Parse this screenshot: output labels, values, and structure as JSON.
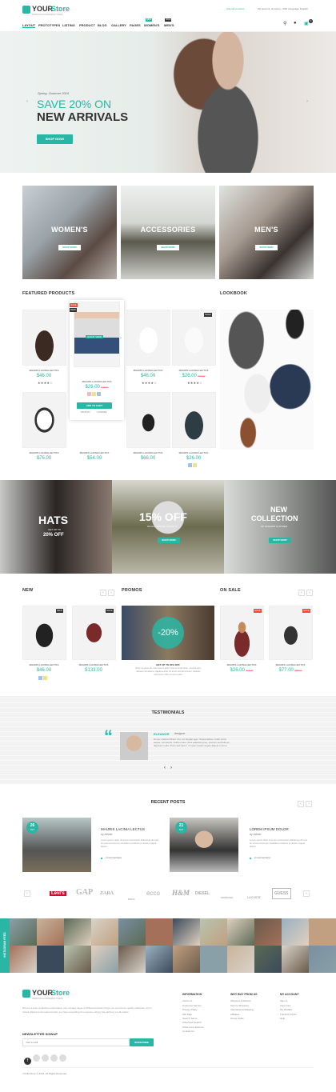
{
  "header": {
    "logo_main": "YOUR",
    "logo_accent": "Store",
    "tagline": "premium ecommerce theme",
    "top_links": [
      "Add all countries",
      "My account",
      "Currency: USD",
      "Language: English"
    ],
    "cart_count": "0",
    "nav": [
      {
        "label": "LAYOUT",
        "active": true
      },
      {
        "label": "PROTOTYPES"
      },
      {
        "label": "LISTING"
      },
      {
        "label": "PRODUCT"
      },
      {
        "label": "BLOG"
      },
      {
        "label": "GALLERY"
      },
      {
        "label": "PAGES"
      },
      {
        "label": "WOMEN'S",
        "badge": "NEW"
      },
      {
        "label": "MEN'S",
        "badge": "SALE"
      }
    ]
  },
  "hero": {
    "eyebrow": "Spring -Summer 2016",
    "line1": "SAVE 20% ON",
    "line2": "NEW ARRIVALS",
    "button": "SHOP NOW!"
  },
  "categories": [
    {
      "label": "WOMEN'S",
      "button": "SHOP NOW!"
    },
    {
      "label": "ACCESSORIES",
      "button": "SHOP NOW!"
    },
    {
      "label": "MEN'S",
      "button": "SHOP NOW!"
    }
  ],
  "featured": {
    "title": "FEATURED PRODUCTS",
    "row1": [
      {
        "name": "MAURIS LACINIA LECTUS",
        "price": "$46.00"
      },
      {
        "name": "MAURIS LACINIA LECTUS",
        "price": "$26.00",
        "old": "$48.00",
        "quick": "QUICK VIEW",
        "button": "ADD TO CART",
        "wish": "WISHLIST",
        "compare": "COMPARE",
        "badge1": "SALE",
        "badge2": "NEW"
      },
      {
        "name": "MAURIS LACINIA LECTUS",
        "price": "$46.00"
      },
      {
        "name": "MAURIS LACINIA LECTUS",
        "price": "$26.00",
        "old": "$48.00",
        "badge1": "SALE"
      }
    ],
    "row2": [
      {
        "name": "MAURIS LACINIA LECTUS",
        "price": "$76.00"
      },
      {
        "name": "MAURIS LACINIA LECTUS",
        "price": "$54.00"
      },
      {
        "name": "MAURIS LACINIA LECTUS",
        "price": "$66.00"
      },
      {
        "name": "MAURIS LACINIA LECTUS",
        "price": "$26.00"
      }
    ]
  },
  "lookbook": {
    "title": "LOOKBOOK"
  },
  "promo_banners": [
    {
      "title": "HATS",
      "sub1": "GET UP TO",
      "sub2": "20% OFF"
    },
    {
      "title": "15% OFF",
      "sub": "ON ALL WINTER JACKETS",
      "button": "SHOP NOW!"
    },
    {
      "title1": "NEW",
      "title2": "COLLECTION",
      "sub": "OF FASHION CLOTHES",
      "button": "SHOP NOW!"
    }
  ],
  "new": {
    "title": "NEW",
    "items": [
      {
        "name": "MAURIS LACINIA LECTUS",
        "price": "$46.00",
        "badge": "NEW"
      },
      {
        "name": "MAURIS LACINIA LECTUS",
        "price": "$133.00",
        "badge": "SALE"
      }
    ]
  },
  "promos": {
    "title": "PROMOS",
    "badge": "-20%",
    "caption": "GET UP TO 20% OFF",
    "text": "Dolor sit amet elit. Nam ipsum dolor. Sed ut turpis dolor, suscipit quis. Aenean vel tellus a, dapibus dolor sit amet, tincidunt lorem. Aliquam sed ipsum dolor sit amet justo."
  },
  "on_sale": {
    "title": "ON SALE",
    "items": [
      {
        "name": "MAURIS LACINIA LECTUS",
        "price": "$26.00",
        "old": "$48.00",
        "badge": "SALE"
      },
      {
        "name": "MAURIS LACINIA LECTUS",
        "price": "$77.00",
        "old": "$88.00",
        "badge": "SALE"
      }
    ]
  },
  "testimonials": {
    "title": "TESTIMONIALS",
    "name": "ELEANOR",
    "role": "designer",
    "quote": "Donec eleifend libero nisi, vel feugiat eget. Suspendisse mollis porta augue, vel iaculis. Nulla ornare risus adipiscing leo, pretium sed felis ac, dignissim odio. Proin sed lorem. Ut quis mauris augue aliquet et arcu."
  },
  "recent_posts": {
    "title": "RECENT POSTS",
    "posts": [
      {
        "day": "26",
        "month": "OCT",
        "title": "MAURIS LACINIA LECTUS",
        "by": "by Admin",
        "text": "Lorem ipsum dolor sit amet consectetur adipiscing elit sed do eiusmod tempor incididunt ut labore et dolore magna aliqua.",
        "comments": "2 comments(s)"
      },
      {
        "day": "21",
        "month": "OCT",
        "title": "LOREM IPSUM DOLOR",
        "by": "by Admin",
        "text": "Lorem ipsum dolor sit amet consectetur adipiscing elit sed do eiusmod tempor incididunt ut labore et dolore magna aliqua.",
        "comments": "2 comments(s)"
      }
    ]
  },
  "brands": [
    "Levi's",
    "GAP",
    "ZARA",
    "POLO",
    "ecco",
    "H&M",
    "DIESEL",
    "OSHKOSH",
    "LACOSTE",
    "GUESS"
  ],
  "instagram": {
    "label": "INSTAGRAM FEED"
  },
  "footer": {
    "logo_main": "YOUR",
    "logo_accent": "Store",
    "tagline": "premium ecommerce theme",
    "about": "We are a team of fashion enthusiasts. Our curated range of different brands brings you a premium quality wardrobe. From classic basics to the latest trends, we have something for everyone. Enjoy free delivery on all orders.",
    "newsletter_title": "NEWSLETTER SIGNUP",
    "newsletter_placeholder": "Your e-mail",
    "newsletter_button": "SUBSCRIBE",
    "cols": [
      {
        "title": "INFORMATION",
        "items": [
          "About Us",
          "Customer Service",
          "Privacy Policy",
          "Site Map",
          "Search Terms",
          "Advanced Search",
          "Orders and Returns",
          "Contact Us"
        ]
      },
      {
        "title": "WHY BUY FROM US",
        "items": [
          "Shipping & Returns",
          "Secure Shopping",
          "International Shipping",
          "Affiliates",
          "Group Sales"
        ]
      },
      {
        "title": "MY ACCOUNT",
        "items": [
          "Sign In",
          "View Cart",
          "My Wishlist",
          "Track My Order",
          "Help"
        ]
      }
    ],
    "copyright": "YOUR Store © 2016. All Rights Reserved."
  },
  "colors": {
    "accent": "#29b6a5",
    "sale": "#e74c3c"
  }
}
